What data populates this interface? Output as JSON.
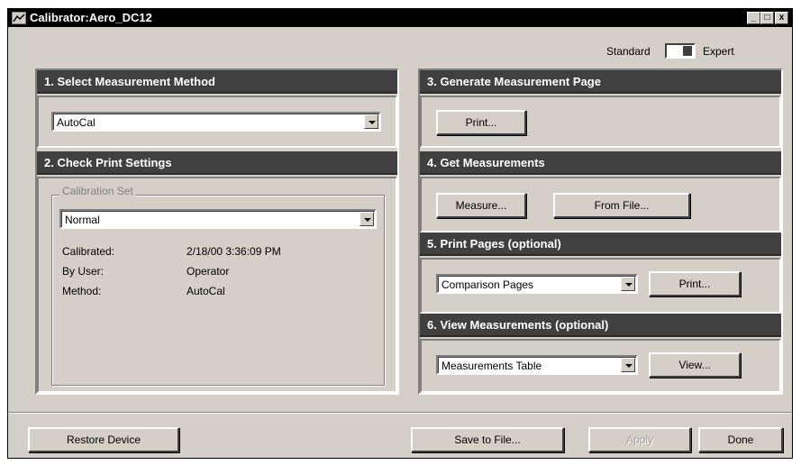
{
  "window": {
    "title": "Calibrator:Aero_DC12",
    "controls": {
      "minimize": "_",
      "maximize": "□",
      "close": "x"
    }
  },
  "mode": {
    "standard_label": "Standard",
    "expert_label": "Expert",
    "selected": "Expert"
  },
  "section1": {
    "header": "1. Select Measurement Method",
    "method": "AutoCal"
  },
  "section2": {
    "header": "2. Check Print Settings",
    "group_label": "Calibration Set",
    "calibration_set": "Normal",
    "info": [
      {
        "label": "Calibrated:",
        "value": "2/18/00 3:36:09 PM"
      },
      {
        "label": "By User:",
        "value": "Operator"
      },
      {
        "label": "Method:",
        "value": "AutoCal"
      }
    ]
  },
  "section3": {
    "header": "3. Generate Measurement Page",
    "print_label": "Print..."
  },
  "section4": {
    "header": "4. Get Measurements",
    "measure_label": "Measure...",
    "from_file_label": "From File..."
  },
  "section5": {
    "header": "5. Print Pages (optional)",
    "pages": "Comparison Pages",
    "print_label": "Print..."
  },
  "section6": {
    "header": "6. View Measurements (optional)",
    "view_type": "Measurements Table",
    "view_label": "View..."
  },
  "footer": {
    "restore_label": "Restore Device",
    "save_label": "Save to File...",
    "apply_label": "Apply",
    "done_label": "Done"
  }
}
